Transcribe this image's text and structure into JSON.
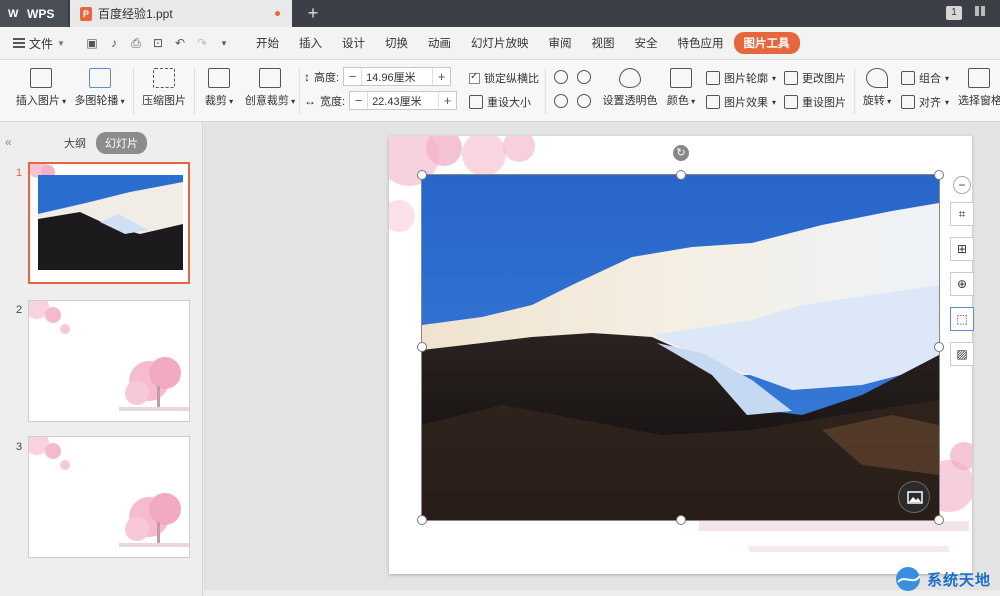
{
  "titlebar": {
    "app_name": "WPS",
    "doc_tab": "百度经验1.ppt",
    "new_tab": "+",
    "window_badge": "1"
  },
  "menubar": {
    "file": "文件",
    "items": [
      "开始",
      "插入",
      "设计",
      "切换",
      "动画",
      "幻灯片放映",
      "审阅",
      "视图",
      "安全",
      "特色应用"
    ],
    "active_tab": "图片工具"
  },
  "ribbon": {
    "insert_picture": "插入图片",
    "carousel": "多图轮播",
    "compress": "压缩图片",
    "crop": "裁剪",
    "creative_crop": "创意裁剪",
    "height_label": "高度:",
    "height_value": "14.96厘米",
    "width_label": "宽度:",
    "width_value": "22.43厘米",
    "lock_ratio": "锁定纵横比",
    "reset_size": "重设大小",
    "set_transparent": "设置透明色",
    "color": "颜色",
    "outline": "图片轮廓",
    "effects": "图片效果",
    "change_picture": "更改图片",
    "reset_picture": "重设图片",
    "rotate": "旋转",
    "group": "组合",
    "align": "对齐",
    "selection_pane": "选择窗格",
    "spin_minus": "−",
    "spin_plus": "+"
  },
  "leftpanel": {
    "collapse": "«",
    "tab_outline": "大纲",
    "tab_slides": "幻灯片",
    "slides": [
      {
        "number": "1"
      },
      {
        "number": "2"
      },
      {
        "number": "3"
      }
    ]
  },
  "floating_tools": [
    "−",
    "⌗",
    "⊞",
    "⊕",
    "⬚",
    "▨"
  ],
  "watermark": {
    "text": "系统天地"
  },
  "colors": {
    "titlebar_bg": "#3c3f45",
    "accent": "#e8663d",
    "sky": "#2a6fd0",
    "watermark": "#1a6fc9"
  }
}
